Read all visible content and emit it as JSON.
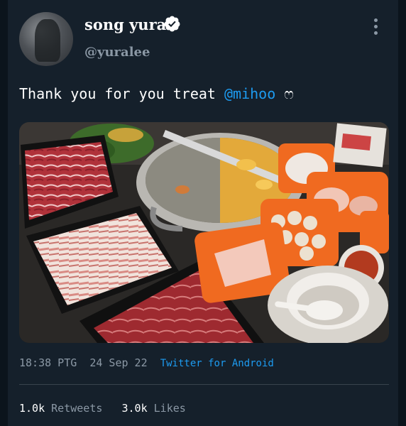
{
  "author": {
    "display_name": "song yura",
    "handle": "@yuralee"
  },
  "tweet": {
    "text": "Thank you for you treat ",
    "mention": "@mihoo",
    "emoji": "ෆ"
  },
  "meta": {
    "time": "18:38 PTG",
    "date": "24 Sep 22",
    "source": "Twitter for Android"
  },
  "stats": {
    "retweets_count": "1.0k",
    "retweets_label": "Retweets",
    "likes_count": "3.0k",
    "likes_label": "Likes"
  },
  "colors": {
    "background": "#15202b",
    "link": "#1d9bf0",
    "secondary_text": "#8b98a5"
  },
  "icons": [
    "verified-badge-icon",
    "more-vertical-icon"
  ]
}
